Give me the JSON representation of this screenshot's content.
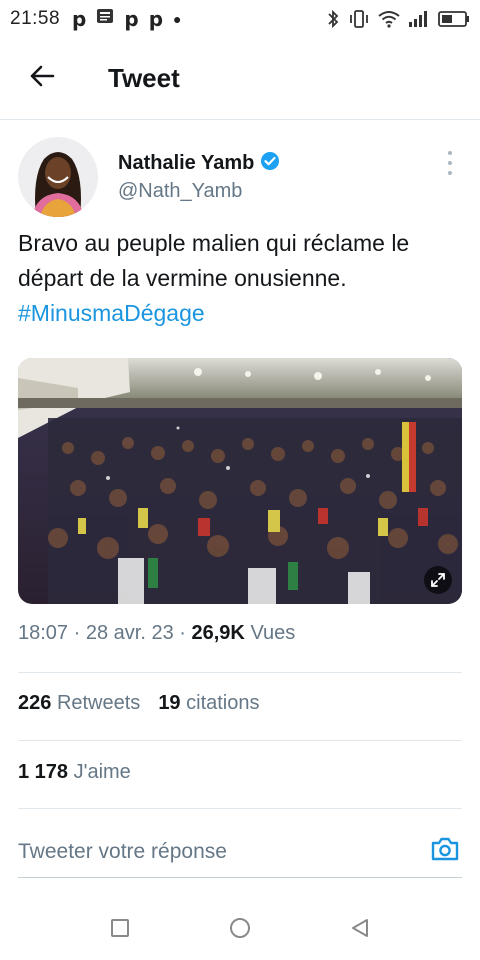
{
  "status_bar": {
    "time": "21:58",
    "notification_icons": [
      "p-notification-icon",
      "news-icon",
      "p-notification-icon",
      "p-notification-icon",
      "dot-icon"
    ],
    "notification_glyph": "p",
    "system_icons": [
      "bluetooth-icon",
      "vibrate-icon",
      "wifi-icon",
      "signal-icon",
      "battery-icon"
    ]
  },
  "header": {
    "title": "Tweet",
    "back_icon": "arrow-left-icon"
  },
  "tweet": {
    "author": {
      "name": "Nathalie Yamb",
      "handle": "@Nath_Yamb",
      "verified_icon": "verified-badge-icon"
    },
    "text": "Bravo au peuple malien qui réclame le départ de la vermine onusienne.",
    "hashtag": "#MinusmaDégage",
    "media_icon": "expand-icon",
    "meta": {
      "time": "18:07",
      "separator": "·",
      "date": "28 avr. 23",
      "views_count": "26,9K",
      "views_label": "Vues"
    },
    "stats": {
      "retweets_count": "226",
      "retweets_label": "Retweets",
      "quotes_count": "19",
      "quotes_label": "citations",
      "likes_count": "1 178",
      "likes_label": "J'aime"
    }
  },
  "reply": {
    "placeholder": "Tweeter votre réponse",
    "camera_icon": "camera-icon"
  },
  "nav_bar": {
    "icons": [
      "square-recents-icon",
      "circle-home-icon",
      "triangle-back-icon"
    ]
  },
  "colors": {
    "accent": "#1b95e0",
    "text_primary": "#14171a",
    "text_secondary": "#657786",
    "divider": "#e1e8ed"
  }
}
